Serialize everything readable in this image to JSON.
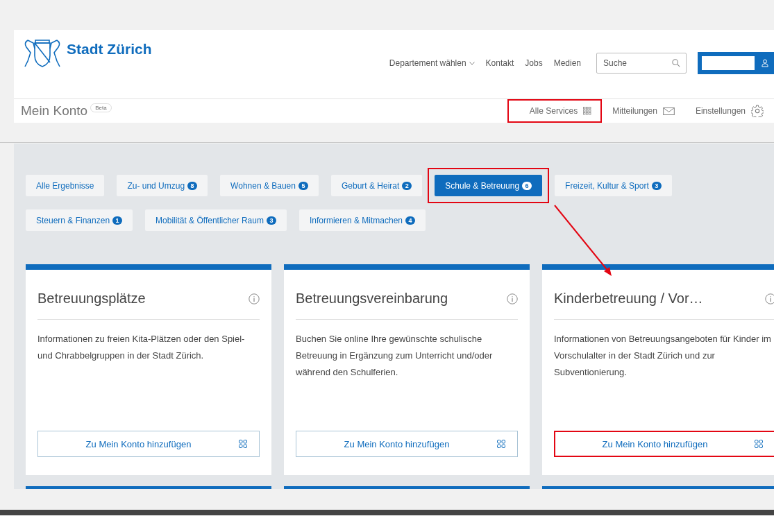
{
  "header": {
    "brand": "Stadt Zürich",
    "nav": [
      {
        "label": "Departement wählen",
        "kind": "dropdown"
      },
      {
        "label": "Kontakt",
        "kind": "link"
      },
      {
        "label": "Jobs",
        "kind": "link"
      },
      {
        "label": "Medien",
        "kind": "link"
      }
    ],
    "search": {
      "placeholder": "Suche"
    }
  },
  "subheader": {
    "title": "Mein Konto",
    "badge": "Beta",
    "links": [
      {
        "label": "Alle Services",
        "kind": "services",
        "highlighted": true
      },
      {
        "label": "Mitteilungen",
        "kind": "messages",
        "highlighted": false
      },
      {
        "label": "Einstellungen",
        "kind": "settings",
        "highlighted": false
      }
    ]
  },
  "filters": [
    {
      "label": "Alle Ergebnisse",
      "selected": false,
      "highlighted": false
    },
    {
      "label": "Zu- und Umzug",
      "count": "8",
      "selected": false,
      "highlighted": false
    },
    {
      "label": "Wohnen & Bauen",
      "count": "5",
      "selected": false,
      "highlighted": false
    },
    {
      "label": "Geburt & Heirat",
      "count": "2",
      "selected": false,
      "highlighted": false
    },
    {
      "label": "Schule & Betreuung",
      "count": "6",
      "selected": true,
      "highlighted": true
    },
    {
      "label": "Freizeit, Kultur & Sport",
      "count": "3",
      "selected": false,
      "highlighted": false
    },
    {
      "label": "Steuern & Finanzen",
      "count": "1",
      "selected": false,
      "highlighted": false
    },
    {
      "label": "Mobilität & Öffentlicher Raum",
      "count": "3",
      "selected": false,
      "highlighted": false
    },
    {
      "label": "Informieren & Mitmachen",
      "count": "4",
      "selected": false,
      "highlighted": false
    }
  ],
  "cards": [
    {
      "title": "Betreuungsplätze",
      "description": "Informationen zu freien Kita-Plätzen oder den Spiel- und Chrabbelgruppen in der Stadt Zürich.",
      "button": "Zu Mein Konto hinzufügen",
      "highlighted": false
    },
    {
      "title": "Betreuungsvereinbarung",
      "description": "Buchen Sie online Ihre gewünschte schulische Betreuung in Ergänzung zum Unterricht und/oder während den Schulferien.",
      "button": "Zu Mein Konto hinzufügen",
      "highlighted": false
    },
    {
      "title": "Kinderbetreuung / Vor…",
      "description": "Informationen von Betreuungsangeboten für Kinder im Vorschulalter in der Stadt Zürich und zur Subventionierung.",
      "button": "Zu Mein Konto hinzufügen",
      "highlighted": true
    }
  ],
  "annotations": {
    "arrow": true
  }
}
